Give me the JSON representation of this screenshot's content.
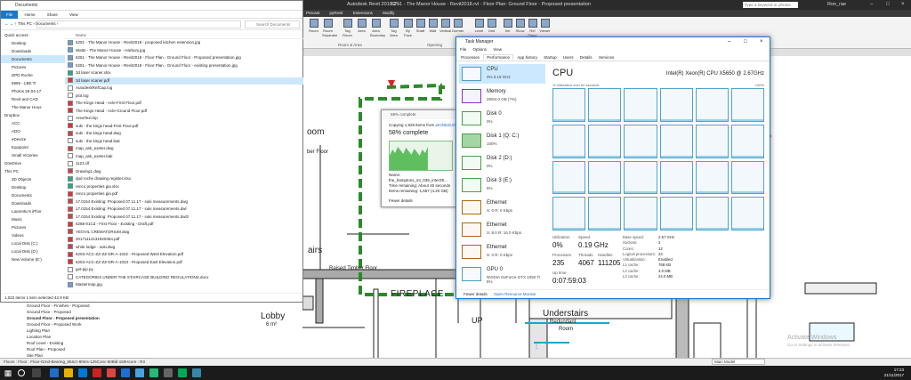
{
  "revit": {
    "title_file": "Autodesk Revit 2018.2 -",
    "title_view": "6251 - The Manor House - Revit2018.rvt - Floor Plan: Ground Floor - Proposed presentation",
    "search_placeholder": "Type a keyword or phrase",
    "user": "Ron_rae",
    "menus": [
      "Precast",
      "pyRevit",
      "Extensions",
      "Modify"
    ],
    "ribbon_buttons": [
      "Room",
      "Room Separator",
      "Tag Room",
      "Area",
      "Area Boundary",
      "Tag Area",
      "By Face",
      "Shaft",
      "Wall",
      "Vertical",
      "Dormer",
      "Level",
      "Grid",
      "Set",
      "Show",
      "Ref Plane",
      "Viewer"
    ],
    "ribbon_groups": [
      "Room & Area",
      "Opening"
    ],
    "drawing_labels": [
      "FIREPLACE",
      "Lobby",
      "6 m²",
      "Raised Timber Floor",
      "Understairs",
      "Redundant",
      "Room",
      "UP",
      "airs",
      "oom",
      "ber Floor"
    ],
    "browser_items": [
      "Ground Floor - Finishes - Proposed",
      "Ground Floor - Proposed",
      "Ground Floor - Proposed presentation",
      "Ground Floor - Proposed Work",
      "Lighting Plan",
      "Location Plan",
      "Roof Level - Existing",
      "Roof Plan - Proposed",
      "Site Plan"
    ],
    "status_text": "Floors : Floor : Floor-Grnd-Bearing_65Scr-80Ins-125Conc-50Bld-150Hcore : R3",
    "main_model": "Main Model",
    "activate_title": "Activate Windows",
    "activate_sub": "Go to Settings to activate Windows."
  },
  "explorer": {
    "title": "Documents",
    "path": "←  →  ↑   This PC  ›  Documents  ›",
    "search_placeholder": "Search Documents",
    "tabs": [
      "File",
      "Home",
      "Share",
      "View"
    ],
    "nav": [
      "Quick access",
      "Desktop",
      "Downloads",
      "Documents",
      "Pictures",
      "DPD Roche",
      "5965 - LBE Tr",
      "Photos 26-04-17",
      "Revit and CAD",
      "The Manor Hous",
      "Dropbox",
      "ACC",
      "ADO",
      "eDevize",
      "Equipoint",
      "Small Victories",
      "OneDrive",
      "This PC",
      "3D Objects",
      "Desktop",
      "Documents",
      "Downloads",
      "Laurentiu's iPhor",
      "Music",
      "Pictures",
      "Videos",
      "Local Disk (C:)",
      "Local Disk (D:)",
      "New Volume (E:)"
    ],
    "col_name": "Name",
    "files": [
      "6251 - The Manor House - Revit2018 - proposed kitchen extension.jpg",
      "Watts - The Manor House - Harbury.jpg",
      "6251 - The Manor House - Revit2018 - Floor Plan - Ground Floor - Proposed presentation.jpg",
      "6251 - The Manor House - Revit2018 - Floor Plan - Ground Floor - existing presentation.jpg",
      "3d laser scaner.xlsx",
      "3d laser scaner.pdf",
      "AutodeskRefCap.log",
      "plot.log",
      "The Kings Head - Acle-First Floor.pdf",
      "The Kings Head - Acle-Ground Floor.pdf",
      "AreaText.lsp",
      "suki - the kings head-First Floor.pdf",
      "suki - the kings head.dwg",
      "suki - the kings head.bak",
      "map_ask_exeter.dwg",
      "map_ask_exeter.bak",
      "1123.clf",
      "Drawing1.dwg",
      "dpd roche drawing register.xlsx",
      "renco properties gia.xlsx",
      "renco properties gia.pdf",
      "17.0154 Existing: Proposed 07.11.17 - suki measurements.dwg",
      "17.0154 Existing: Proposed 07.11.17 - suki measurements.dwl",
      "17.0154 Existing: Proposed 07.11.17 - suki measurements.dwl2",
      "6288-01Cd - First Floor - Existing - Draft.pdf",
      "YEOVIL CREMATORIUM.dwg",
      "20171114131920354.pdf",
      "white lodge - suki.dwg",
      "6203-ACC-ZZ-ZZ-DR-A-1022 - Proposed West Elevation.pdf",
      "6203-ACC-ZZ-ZZ-DR-A-1023 - Proposed East Elevation.pdf",
      "get-pip.py",
      "CATEGORIES UNDER THE STAIRCASE BUILDING REGULATIONS.docx",
      "Mastermap.jpg"
    ],
    "selected_index": 5,
    "status": "1,022 items    1 item selected  42.9 KB"
  },
  "copy_dialog": {
    "title": "58% complete",
    "line1": "Copying 1,929 items from",
    "link": "pIONEdUOU",
    "percent": "58% complete",
    "name": "Name: the_hamptons_int_039_inter29...",
    "time": "Time remaining: About 45 seconds",
    "items": "Items remaining: 1,657 (4.20 GB)",
    "fewer": "Fewer details",
    "progress": 0.58
  },
  "task_manager": {
    "title": "Task Manager",
    "menu": [
      "File",
      "Options",
      "View"
    ],
    "tabs": [
      "Processes",
      "Performance",
      "App history",
      "Startup",
      "Users",
      "Details",
      "Services"
    ],
    "active_tab": "Performance",
    "resources": [
      {
        "name": "CPU",
        "sub": "0%  0.19 GHz"
      },
      {
        "name": "Memory",
        "sub": "29/64.0 GB (?%)"
      },
      {
        "name": "Disk 0",
        "sub": "0%"
      },
      {
        "name": "Disk 1 (Q: C:)",
        "sub": "100%"
      },
      {
        "name": "Disk 2 (D:)",
        "sub": "0%"
      },
      {
        "name": "Disk 3 (E:)",
        "sub": "5%"
      },
      {
        "name": "Ethernet",
        "sub": "S: 0  R: 0 Kbps"
      },
      {
        "name": "Ethernet",
        "sub": "S: 8.0  R: 16.0 Kbps"
      },
      {
        "name": "Ethernet",
        "sub": "S: 0  R: 0 Kbps"
      },
      {
        "name": "GPU 0",
        "sub": "NVIDIA GeForce GTX 1050 Ti",
        "sub2": "5%"
      }
    ],
    "cpu_title": "CPU",
    "cpu_model": "Intel(R) Xeon(R) CPU X5650 @ 2.67GHz",
    "util_label": "% Utilization over 60 seconds",
    "util_max": "100%",
    "stats": {
      "utilization_label": "Utilization",
      "utilization": "0%",
      "speed_label": "Speed",
      "speed": "0.19 GHz",
      "processes_label": "Processes",
      "processes": "235",
      "threads_label": "Threads",
      "threads": "4067",
      "handles_label": "Handles",
      "handles": "111205",
      "uptime_label": "Up time",
      "uptime": "0:07:59:03"
    },
    "details": [
      {
        "k": "Base speed:",
        "v": "2.67 GHz"
      },
      {
        "k": "Sockets:",
        "v": "2"
      },
      {
        "k": "Cores:",
        "v": "12"
      },
      {
        "k": "Logical processors:",
        "v": "24"
      },
      {
        "k": "Virtualization:",
        "v": "Enabled"
      },
      {
        "k": "L1 cache:",
        "v": "768 KB"
      },
      {
        "k": "L2 cache:",
        "v": "3.0 MB"
      },
      {
        "k": "L3 cache:",
        "v": "24.0 MB"
      }
    ],
    "fewer": "Fewer details",
    "monitor": "Open Resource Monitor"
  },
  "taskbar": {
    "time": "17:23",
    "date": "21/11/2017"
  }
}
